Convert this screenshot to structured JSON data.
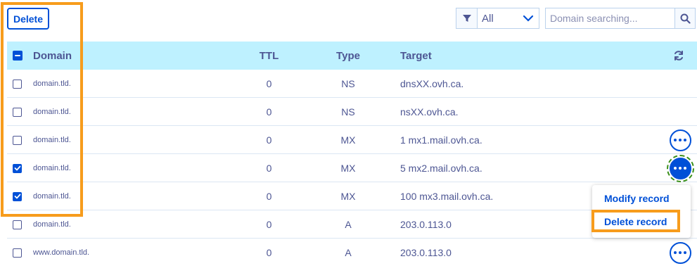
{
  "toolbar": {
    "delete_label": "Delete",
    "filter_icon": "filter-icon",
    "filter_value": "All",
    "search_placeholder": "Domain searching...",
    "search_icon": "search-icon"
  },
  "table": {
    "headers": {
      "domain": "Domain",
      "ttl": "TTL",
      "type": "Type",
      "target": "Target",
      "refresh_icon": "refresh-icon"
    },
    "rows": [
      {
        "domain": "domain.tld.",
        "ttl": "0",
        "type": "NS",
        "target": "dnsXX.ovh.ca.",
        "checked": false,
        "action": "none"
      },
      {
        "domain": "domain.tld.",
        "ttl": "0",
        "type": "NS",
        "target": "nsXX.ovh.ca.",
        "checked": false,
        "action": "none"
      },
      {
        "domain": "domain.tld.",
        "ttl": "0",
        "type": "MX",
        "target": "1 mx1.mail.ovh.ca.",
        "checked": false,
        "action": "button"
      },
      {
        "domain": "domain.tld.",
        "ttl": "0",
        "type": "MX",
        "target": "5 mx2.mail.ovh.ca.",
        "checked": true,
        "action": "active"
      },
      {
        "domain": "domain.tld.",
        "ttl": "0",
        "type": "MX",
        "target": "100 mx3.mail.ovh.ca.",
        "checked": true,
        "action": "none"
      },
      {
        "domain": "domain.tld.",
        "ttl": "0",
        "type": "A",
        "target": "203.0.113.0",
        "checked": false,
        "action": "none"
      },
      {
        "domain": "www.domain.tld.",
        "ttl": "0",
        "type": "A",
        "target": "203.0.113.0",
        "checked": false,
        "action": "button"
      }
    ]
  },
  "context_menu": {
    "items": [
      {
        "label": "Modify record"
      },
      {
        "label": "Delete record"
      }
    ]
  },
  "colors": {
    "accent": "#0050d7",
    "header_bg": "#bef1ff",
    "text": "#4d5693",
    "highlight": "#f79c1c"
  }
}
